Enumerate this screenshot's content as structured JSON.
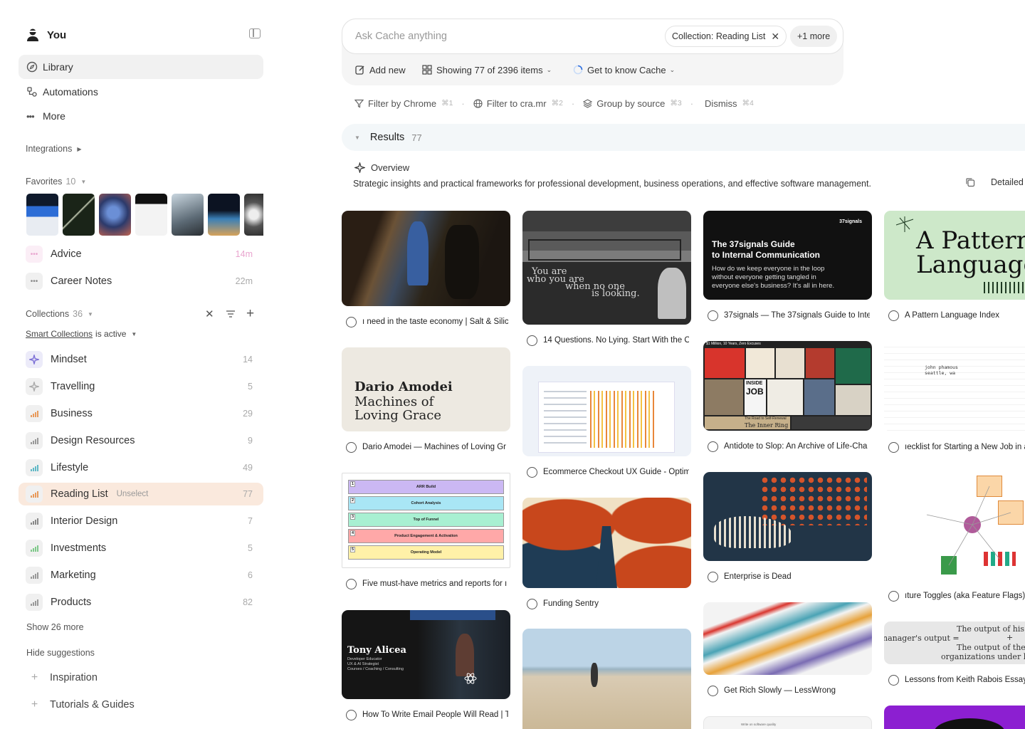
{
  "user": {
    "name": "You"
  },
  "nav": {
    "library": "Library",
    "automations": "Automations",
    "more": "More"
  },
  "integrations": {
    "label": "Integrations"
  },
  "favorites": {
    "label": "Favorites",
    "count": "10",
    "thumbnails": [
      "#274472",
      "#2f3d2e",
      "#3b5b8c",
      "#1a1a1a",
      "#6d7a86",
      "#25466b",
      "#555555"
    ],
    "items": [
      {
        "label": "Advice",
        "time": "14m",
        "icon": "dots-icon",
        "color": "#e9a5cf"
      },
      {
        "label": "Career Notes",
        "time": "22m",
        "icon": "dots-icon",
        "color": "#888888"
      }
    ]
  },
  "collections": {
    "label": "Collections",
    "count": "36",
    "smart_label": "Smart Collections",
    "smart_status": "is active",
    "items": [
      {
        "label": "Mindset",
        "count": "14",
        "icon": "sparkle-icon",
        "color": "#7c6fd6"
      },
      {
        "label": "Travelling",
        "count": "5",
        "icon": "sparkle-icon",
        "color": "#aaaaaa"
      },
      {
        "label": "Business",
        "count": "29",
        "icon": "bar-chart-icon",
        "color": "#e89a5b"
      },
      {
        "label": "Design Resources",
        "count": "9",
        "icon": "bar-chart-icon",
        "color": "#999999"
      },
      {
        "label": "Lifestyle",
        "count": "49",
        "icon": "bar-chart-icon",
        "color": "#5fb8c6"
      },
      {
        "label": "Reading List",
        "count": "77",
        "icon": "bar-chart-icon",
        "color": "#e89a5b",
        "action": "Unselect"
      },
      {
        "label": "Interior Design",
        "count": "7",
        "icon": "bar-chart-icon",
        "color": "#888888"
      },
      {
        "label": "Investments",
        "count": "5",
        "icon": "bar-chart-icon",
        "color": "#7fc98a"
      },
      {
        "label": "Marketing",
        "count": "6",
        "icon": "bar-chart-icon",
        "color": "#999999"
      },
      {
        "label": "Products",
        "count": "82",
        "icon": "bar-chart-icon",
        "color": "#999999"
      }
    ],
    "show_more": "Show 26 more"
  },
  "suggestions": {
    "hide_label": "Hide suggestions",
    "items": [
      "Inspiration",
      "Tutorials & Guides"
    ]
  },
  "search": {
    "placeholder": "Ask Cache anything",
    "filter_chip": "Collection: Reading List",
    "more_chip": "+1 more"
  },
  "toolbar": {
    "add_new": "Add new",
    "showing": "Showing 77 of 2396 items",
    "get_to_know": "Get to know Cache"
  },
  "filters": [
    {
      "label": "Filter by Chrome",
      "shortcut": "⌘1"
    },
    {
      "label": "Filter to cra.mr",
      "shortcut": "⌘2"
    },
    {
      "label": "Group by source",
      "shortcut": "⌘3"
    },
    {
      "label": "Dismiss",
      "shortcut": "⌘4"
    }
  ],
  "results": {
    "label": "Results",
    "count": "77"
  },
  "overview": {
    "label": "Overview",
    "text": "Strategic insights and practical frameworks for professional development, business operations, and effective software management.",
    "detailed": "Detailed"
  },
  "cards": {
    "c1": {
      "title": "ı need in the taste economy | Salt & Silic"
    },
    "c2": {
      "title": "Dario Amodei — Machines of Loving Gr",
      "img_l1": "Dario Amodei",
      "img_l2": "Machines of",
      "img_l3": "Loving Grace"
    },
    "c3": {
      "title": "Five must-have metrics and reports for ı",
      "rows": [
        "ARR Build",
        "Cohort Analysis",
        "Top of Funnel",
        "Product Engagement & Activation",
        "Operating Model"
      ],
      "nums": [
        "1",
        "2",
        "3",
        "4",
        "5"
      ],
      "colors": [
        "#cbb8f3",
        "#a9e6f5",
        "#a8f0d2",
        "#ffa8a8",
        "#fff1a8"
      ]
    },
    "c4": {
      "title": "How To Write Email People Will Read | T",
      "img_name": "Tony Alicea",
      "img_sub1": "Developer Educator",
      "img_sub2": "UX & AI Strategist",
      "img_sub3": "Courses / Coaching / Consulting"
    },
    "c5": {
      "title": "14 Questions. No Lying. Start With the O",
      "img_line1": "You are",
      "img_line2": "who you are",
      "img_line3": "when no one",
      "img_line4": "is looking."
    },
    "c6": {
      "title": "Ecommerce Checkout UX Guide - Optim"
    },
    "c7": {
      "title": "Funding Sentry"
    },
    "c8": {
      "title": ""
    },
    "c9": {
      "title": "37signals — The 37signals Guide to Inte",
      "img_brand": "37signals",
      "img_title1": "The 37signals Guide",
      "img_title2": "to Internal Communication",
      "img_b1": "How do we keep everyone in the loop",
      "img_b2": "without everyone getting tangled in",
      "img_b3": "everyone else's business? It's all in here."
    },
    "c10": {
      "title": "Antidote to Slop: An Archive of Life-Cha",
      "img_top": "$1 Million, 10 Years, Zero Excuses",
      "img_job1": "INSIDE",
      "img_job2": "JOB",
      "img_road": "The Road to Self-Renewal",
      "img_ring": "The Inner Ring"
    },
    "c11": {
      "title": "Enterprise is Dead"
    },
    "c12": {
      "title": "Get Rich Slowly — LessWrong"
    },
    "c13": {
      "title": "A Pattern Language Index",
      "img_l1": "A Pattern",
      "img_l2": "Language"
    },
    "c14": {
      "title": "ıecklist for Starting a New Job in a",
      "img_l1": "john phamous",
      "img_l2": "seattle, wa"
    },
    "c15": {
      "title": "ıture Toggles (aka Feature Flags)"
    },
    "c16": {
      "title": "Lessons from Keith Rabois Essay",
      "img_l1": "The output of his o",
      "img_l2": "nanager's output =",
      "img_l3": "+",
      "img_l4": "The output of the n",
      "img_l5": "organizations under h"
    },
    "c17": {
      "title": ""
    },
    "c18": {
      "title": "",
      "img_l1": "Write on software quality"
    }
  }
}
